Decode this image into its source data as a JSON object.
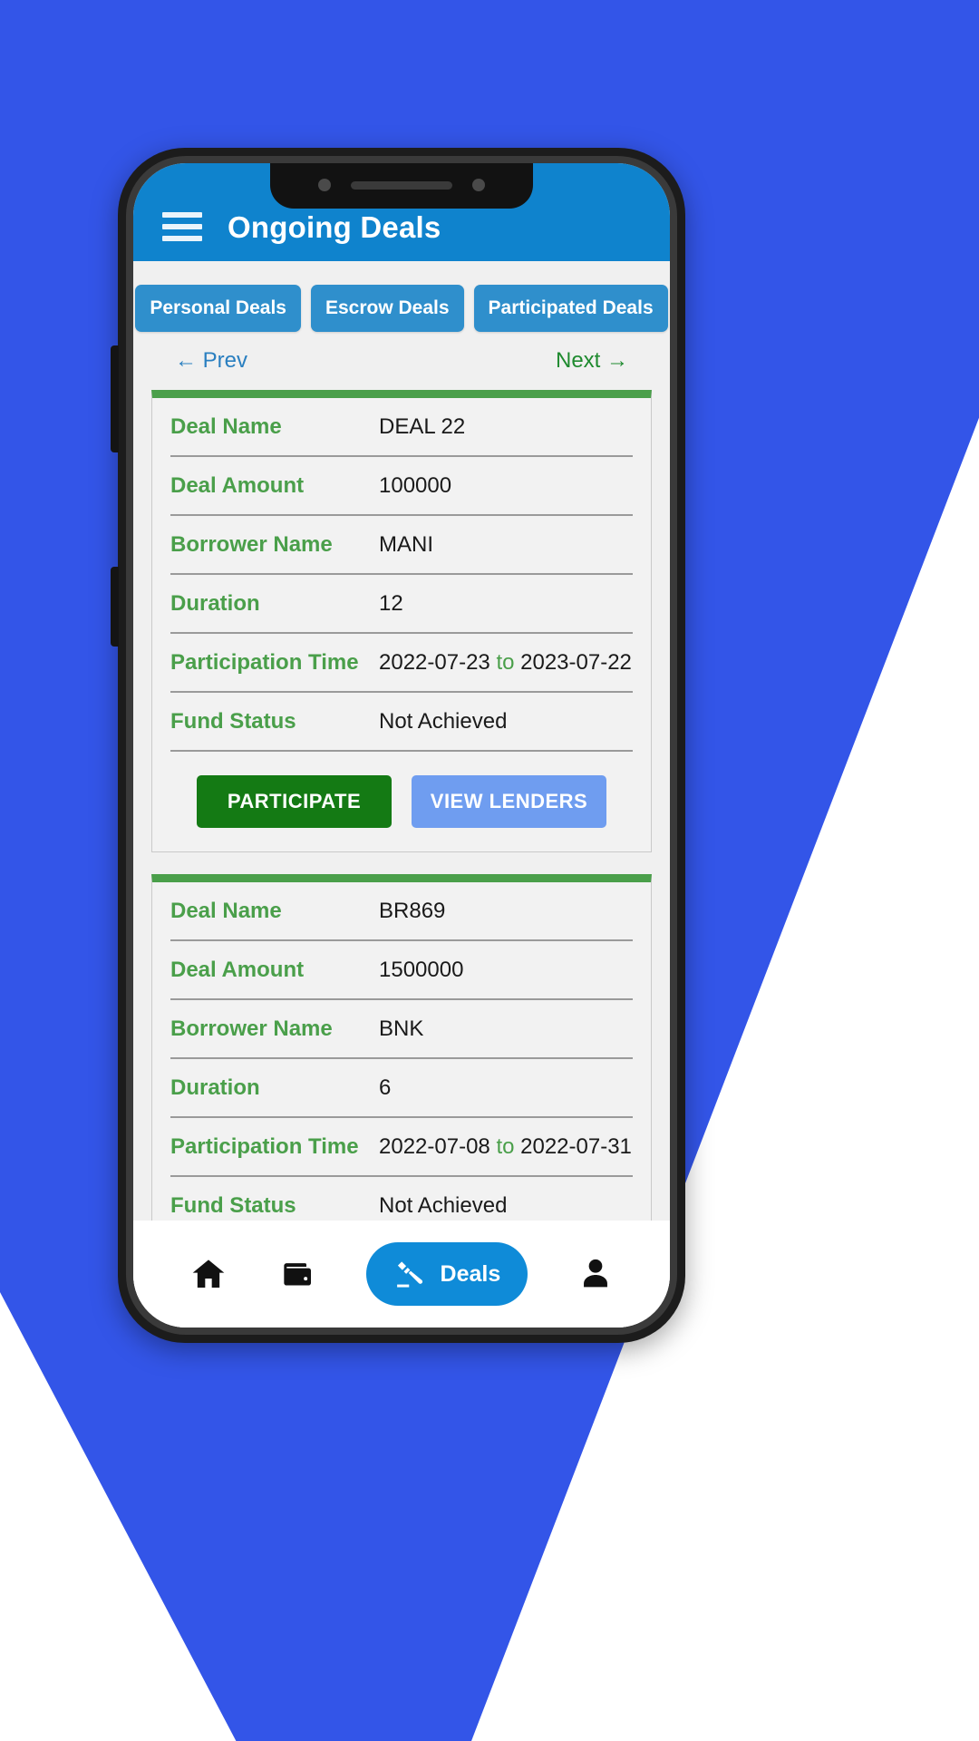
{
  "colors": {
    "page_background": "#3355e8",
    "appbar": "#0f83cd",
    "tab": "#2f8fcc",
    "card_top_accent": "#4a9f4a",
    "label_green": "#4a9f4a",
    "participate_green": "#147a14",
    "view_lenders_blue": "#6f9df0",
    "prev_blue": "#2a7fc0",
    "next_green": "#1f8a2f",
    "nav_pill_blue": "#0f8bd8"
  },
  "appbar": {
    "menu_icon": "hamburger-menu-icon",
    "title": "Ongoing Deals"
  },
  "tabs": [
    {
      "label": "Personal Deals",
      "name": "tab-personal-deals"
    },
    {
      "label": "Escrow Deals",
      "name": "tab-escrow-deals"
    },
    {
      "label": "Participated Deals",
      "name": "tab-participated-deals"
    }
  ],
  "pager": {
    "prev_label": "← Prev",
    "next_label": "Next →"
  },
  "labels": {
    "deal_name": "Deal Name",
    "deal_amount": "Deal Amount",
    "borrower_name": "Borrower Name",
    "duration": "Duration",
    "participation_time": "Participation Time",
    "fund_status": "Fund Status"
  },
  "actions": {
    "participate": "PARTICIPATE",
    "view_lenders": "VIEW LENDERS"
  },
  "separator_word": "to",
  "cards": [
    {
      "deal_name": "DEAL 22",
      "deal_amount": "100000",
      "borrower_name": "MANI",
      "duration": "12",
      "participation_start": "2022-07-23",
      "participation_end": "2023-07-22",
      "fund_status": "Not Achieved"
    },
    {
      "deal_name": "BR869",
      "deal_amount": "1500000",
      "borrower_name": "BNK",
      "duration": "6",
      "participation_start": "2022-07-08",
      "participation_end": "2022-07-31",
      "fund_status": "Not Achieved"
    }
  ],
  "bottom_nav": [
    {
      "name": "nav-home",
      "icon": "home-icon",
      "label": ""
    },
    {
      "name": "nav-wallet",
      "icon": "wallet-icon",
      "label": ""
    },
    {
      "name": "nav-deals",
      "icon": "gavel-icon",
      "label": "Deals"
    },
    {
      "name": "nav-profile",
      "icon": "person-icon",
      "label": ""
    }
  ]
}
